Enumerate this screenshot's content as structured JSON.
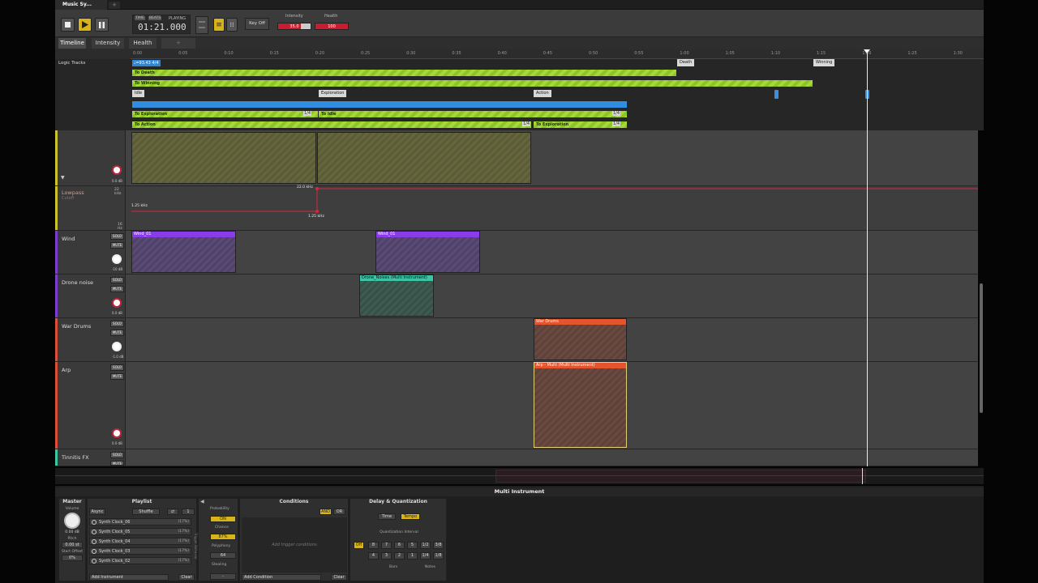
{
  "window": {
    "tab_title": "Music Sy..."
  },
  "toolbar": {
    "clock_modes": [
      "TIME",
      "BEATS"
    ],
    "playing_label": "PLAYING",
    "time": "01:21.000",
    "key_off": "Key Off",
    "intensity_label": "Intensity",
    "intensity_value": "35.0",
    "intensity_level": 0.35,
    "health_label": "Health",
    "health_value": "100"
  },
  "view_tabs": [
    "Timeline",
    "Intensity",
    "Health"
  ],
  "ruler_ticks": [
    "0:00",
    "0:05",
    "0:10",
    "0:15",
    "0:20",
    "0:25",
    "0:30",
    "0:35",
    "0:40",
    "0:45",
    "0:50",
    "0:55",
    "1:00",
    "1:05",
    "1:10",
    "1:15",
    "1:20",
    "1:25",
    "1:30"
  ],
  "logic": {
    "label": "Logic Tracks",
    "tempo": "♩=93.43 4/4",
    "markers": [
      "Death",
      "Winning",
      "Idle",
      "Exploration",
      "Action"
    ],
    "bars": [
      "To Death",
      "To Winning",
      "To Exploration",
      "To Idle",
      "To Action",
      "To Exploration"
    ],
    "fractions": [
      "1/4",
      "1/4",
      "1/4",
      "1/4"
    ]
  },
  "tracks": [
    {
      "name": "",
      "db": "0.0 dB"
    },
    {
      "name": "Lowpass",
      "sub": "Cutoff",
      "max": "22 kHz",
      "min": "16 Hz",
      "point_top": "22.0 kHz",
      "point_left": "1.25 kHz",
      "point_bottom": "1.25 kHz"
    },
    {
      "name": "Wind",
      "db": "-10 dB",
      "clips": [
        "Wind_01",
        "Wind_01"
      ]
    },
    {
      "name": "Drone noise",
      "db": "0.0 dB",
      "clips": [
        "Drone_Noises (Multi Instrument)"
      ]
    },
    {
      "name": "War Drums",
      "db": "-1.0 dB",
      "clips": [
        "War Drums"
      ]
    },
    {
      "name": "Arp",
      "db": "0.0 dB",
      "clips": [
        "Arp - Multi (Multi Instrument)"
      ]
    },
    {
      "name": "Tinnitis FX"
    }
  ],
  "buttons": {
    "solo": "SOLO",
    "mute": "MUTE"
  },
  "bottom": {
    "title": "Multi Instrument",
    "master": {
      "title": "Master",
      "volume": "Volume",
      "volume_db": "0.00 dB",
      "pitch": "Pitch",
      "pitch_val": "0.00 st",
      "start_offset": "Start Offset",
      "start_val": "0%",
      "async": "Async"
    },
    "playlist": {
      "title": "Playlist",
      "mode": "Shuffle",
      "count": "1",
      "items": [
        {
          "name": "Synth Clock_06",
          "pct": "(17%)"
        },
        {
          "name": "Synth Clock_05",
          "pct": "(17%)"
        },
        {
          "name": "Synth Clock_04",
          "pct": "(17%)"
        },
        {
          "name": "Synth Clock_03",
          "pct": "(17%)"
        },
        {
          "name": "Synth Clock_02",
          "pct": "(17%)"
        }
      ],
      "add": "Add Instrument",
      "clear": "Clear"
    },
    "trigger": {
      "side_label": "Trigger Behavior",
      "probability": "Probability",
      "on": "ON",
      "chance": "Chance",
      "chance_val": "87%",
      "polyphony": "Polyphony",
      "poly_val": "64",
      "stealing": "Stealing",
      "steal_val": "-"
    },
    "conditions": {
      "title": "Conditions",
      "and": "AND",
      "or": "OR",
      "placeholder": "Add trigger conditions",
      "add": "Add Condition",
      "clear": "Clear"
    },
    "delay": {
      "title": "Delay & Quantization",
      "time": "Time",
      "tempo": "Tempo",
      "interval": "Quantization Interval",
      "off": "Off",
      "row1": [
        "8",
        "7",
        "6",
        "5",
        "1/2",
        "3/8"
      ],
      "row2": [
        "4",
        "3",
        "2",
        "1",
        "1/4",
        "1/8"
      ],
      "bars": "Bars",
      "notes": "Notes"
    }
  }
}
